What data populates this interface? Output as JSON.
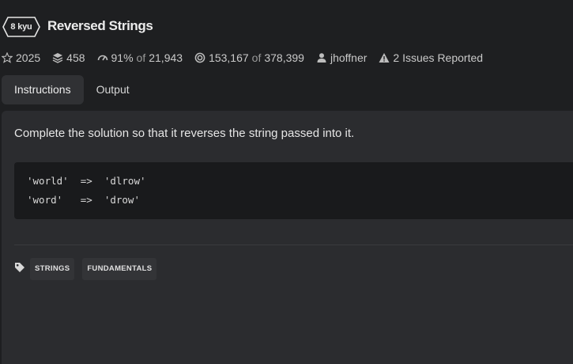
{
  "kata": {
    "rank": "8 kyu",
    "title": "Reversed Strings"
  },
  "stats": {
    "stars": "2025",
    "collections": "458",
    "satisfaction_pct": "91%",
    "satisfaction_of": "of",
    "satisfaction_votes": "21,943",
    "completed": "153,167",
    "completed_of": "of",
    "attempted": "378,399",
    "author": "jhoffner",
    "issues": "2 Issues Reported"
  },
  "tabs": [
    {
      "label": "Instructions",
      "active": true
    },
    {
      "label": "Output",
      "active": false
    }
  ],
  "instructions": {
    "description": "Complete the solution so that it reverses the string passed into it.",
    "code_lines": [
      "'world'  =>  'dlrow'",
      "'word'   =>  'drow'"
    ]
  },
  "tags": [
    "STRINGS",
    "FUNDAMENTALS"
  ],
  "colors": {
    "background": "#1e1f21",
    "panel": "#2b2c2f",
    "code_background": "#191a1c",
    "active_tab": "#303134"
  }
}
